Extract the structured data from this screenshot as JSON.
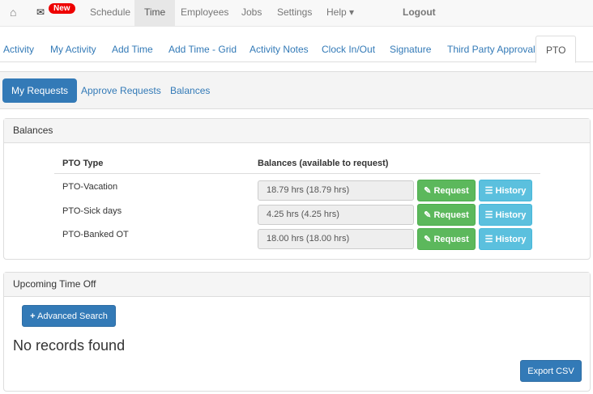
{
  "nav": {
    "badge": "New",
    "items": [
      "Schedule",
      "Time",
      "Employees",
      "Jobs",
      "Settings",
      "Help ▾",
      "Logout"
    ]
  },
  "tabs": [
    "Activity",
    "My Activity",
    "Add Time",
    "Add Time - Grid",
    "Activity Notes",
    "Clock In/Out",
    "Signature",
    "Third Party Approval",
    "PTO"
  ],
  "subtabs": [
    "My Requests",
    "Approve Requests",
    "Balances"
  ],
  "balances": {
    "title": "Balances",
    "col_type": "PTO Type",
    "col_bal": "Balances (available to request)",
    "request": "Request",
    "history": "History",
    "rows": [
      {
        "type": "PTO-Vacation",
        "value": "18.79 hrs (18.79 hrs)"
      },
      {
        "type": "PTO-Sick days",
        "value": "4.25 hrs (4.25 hrs)"
      },
      {
        "type": "PTO-Banked OT",
        "value": "18.00 hrs (18.00 hrs)"
      }
    ]
  },
  "upcoming": {
    "title": "Upcoming Time Off",
    "search": "Advanced Search",
    "empty": "No records found",
    "export": "Export CSV"
  }
}
